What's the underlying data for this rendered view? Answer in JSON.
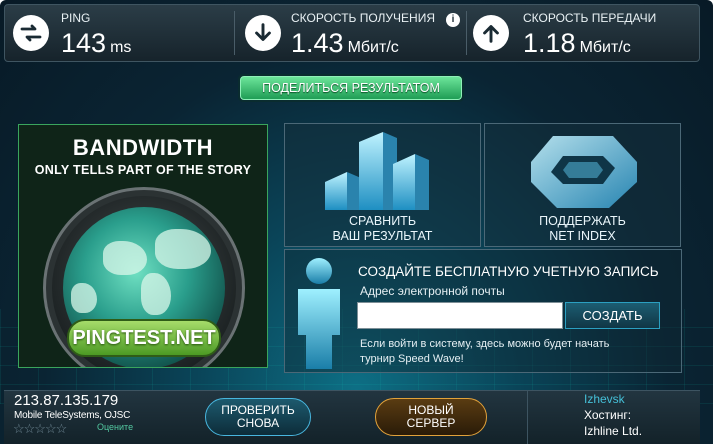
{
  "stats": {
    "ping": {
      "label": "PING",
      "value": "143",
      "unit": "ms"
    },
    "download": {
      "label": "СКОРОСТЬ ПОЛУЧЕНИЯ",
      "value": "1.43",
      "unit": "Мбит/с",
      "info": "i"
    },
    "upload": {
      "label": "СКОРОСТЬ ПЕРЕДАЧИ",
      "value": "1.18",
      "unit": "Мбит/с"
    }
  },
  "share_label": "ПОДЕЛИТЬСЯ РЕЗУЛЬТАТОМ",
  "ad": {
    "title": "BANDWIDTH",
    "subtitle": "ONLY TELLS PART OF THE STORY",
    "brand": "PINGTEST.NET"
  },
  "compare": {
    "line1": "СРАВНИТЬ",
    "line2": "ВАШ РЕЗУЛЬТАТ"
  },
  "netindex": {
    "line1": "ПОДДЕРЖАТЬ",
    "line2": "NET INDEX"
  },
  "account": {
    "title": "СОЗДАЙТЕ БЕСПЛАТНУЮ УЧЕТНУЮ ЗАПИСЬ",
    "email_label": "Адрес электронной почты",
    "email_value": "",
    "create_label": "СОЗДАТЬ",
    "note_line1": "Если войти в систему, здесь можно будет начать",
    "note_line2": "турнир Speed Wave!"
  },
  "client": {
    "ip": "213.87.135.179",
    "isp": "Mobile TeleSystems, OJSC",
    "rate_label": "Оцените"
  },
  "retest": {
    "line1": "ПРОВЕРИТЬ",
    "line2": "СНОВА"
  },
  "new_server": {
    "line1": "НОВЫЙ",
    "line2": "СЕРВЕР"
  },
  "server": {
    "city": "Izhevsk",
    "host_label": "Хостинг:",
    "host": "Izhline Ltd."
  },
  "colors": {
    "accent_green": "#3ec97a",
    "accent_blue": "#2b9fc1",
    "new_server_orange": "#e2a23a",
    "city_teal": "#45c0d8"
  }
}
